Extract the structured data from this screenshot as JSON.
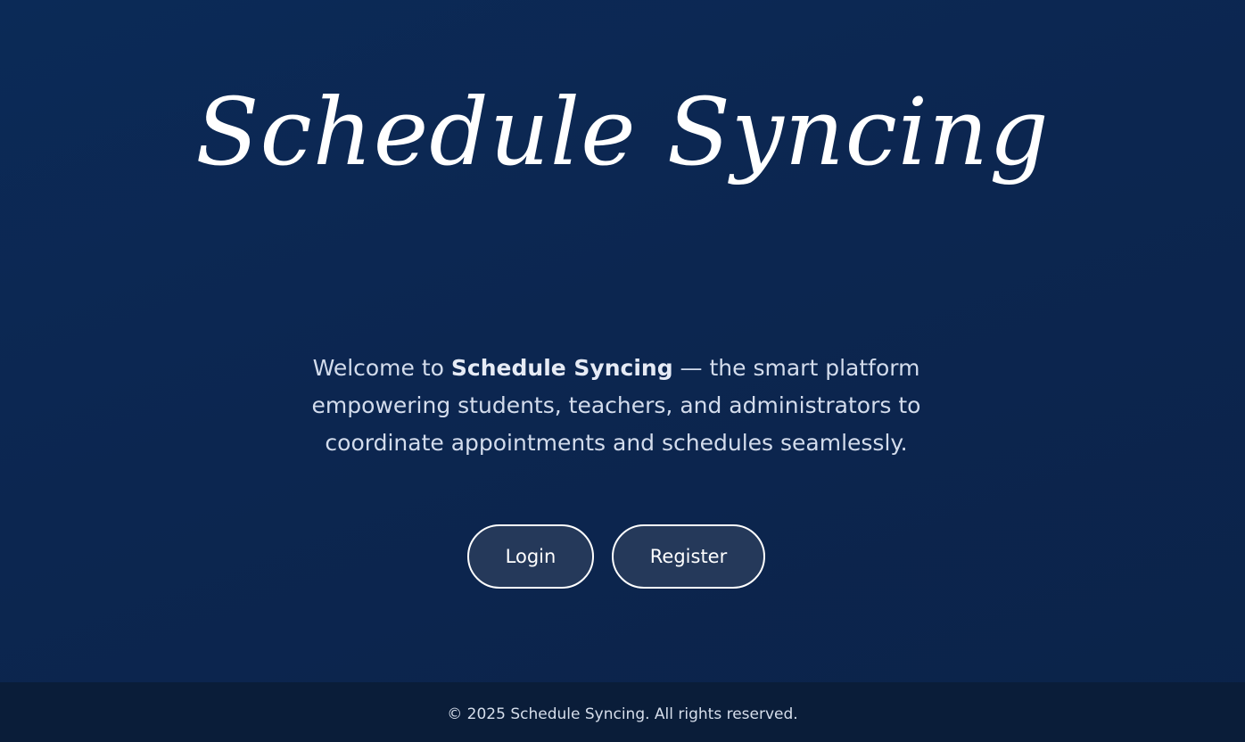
{
  "hero": {
    "title": "Schedule Syncing",
    "welcome": {
      "prefix": "Welcome to ",
      "brand": "Schedule Syncing",
      "suffix": " — the smart platform empowering students, teachers, and administrators to coordinate appointments and schedules seamlessly."
    }
  },
  "actions": {
    "login_label": "Login",
    "register_label": "Register"
  },
  "footer": {
    "copyright": "© 2025 Schedule Syncing. All rights reserved."
  },
  "colors": {
    "background": "#0b2a57",
    "button_fill": "#25395a",
    "button_border": "#ffffff",
    "footer_background": "#0a1d39",
    "body_text": "#d3dcec"
  }
}
